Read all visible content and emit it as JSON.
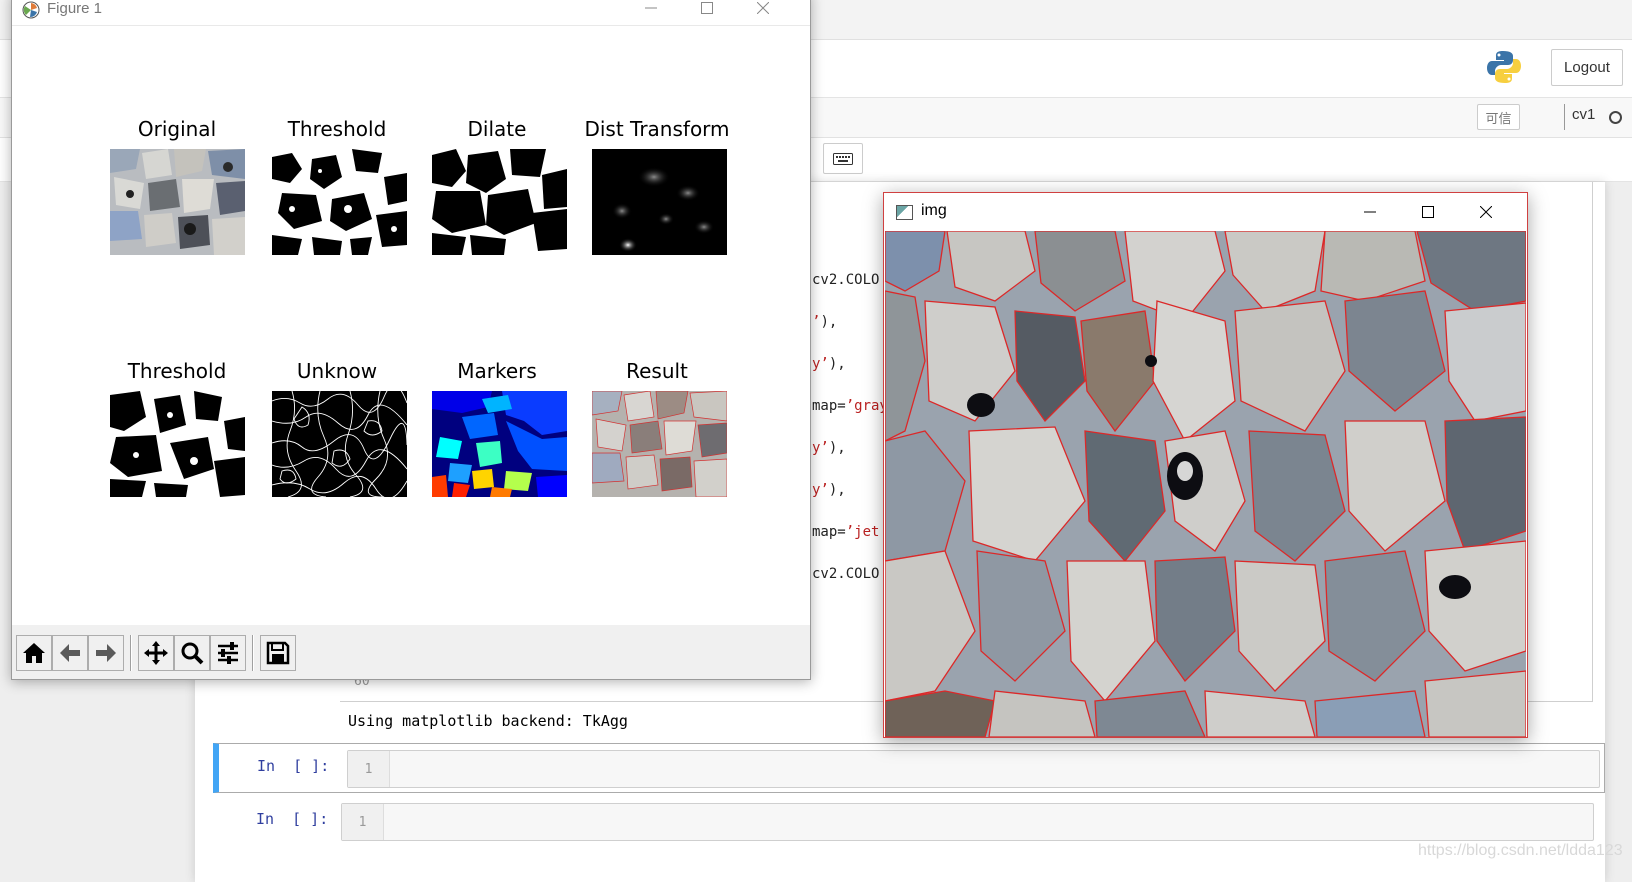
{
  "jupyter": {
    "logout_label": "Logout",
    "trusted_label": "可信",
    "kernel_name": "cv1",
    "code_fragments": [
      {
        "pre": "cv2.COLO",
        "str": "",
        "post": ""
      },
      {
        "pre": "",
        "str": "’",
        "post": "),"
      },
      {
        "pre": "",
        "str": "y’",
        "post": "),"
      },
      {
        "pre": "map=",
        "str": "’gray",
        "post": ""
      },
      {
        "pre": "",
        "str": "y’",
        "post": "),"
      },
      {
        "pre": "",
        "str": "y’",
        "post": "),"
      },
      {
        "pre": "map=",
        "str": "’jet",
        "post": ""
      },
      {
        "pre": "cv2.COLO",
        "str": "",
        "post": ""
      }
    ],
    "last_line_number": "60",
    "output_text": "Using matplotlib backend: TkAgg",
    "cells": [
      {
        "prompt": "In  [ ]:",
        "line": "1"
      },
      {
        "prompt": "In  [ ]:",
        "line": "1"
      }
    ],
    "watermark": "https://blog.csdn.net/ldda123"
  },
  "figure_window": {
    "title": "Figure 1",
    "subplots": [
      {
        "title": "Original"
      },
      {
        "title": "Threshold"
      },
      {
        "title": "Dilate"
      },
      {
        "title": "Dist Transform"
      },
      {
        "title": "Threshold"
      },
      {
        "title": "Unknow"
      },
      {
        "title": "Markers"
      },
      {
        "title": "Result"
      }
    ],
    "toolbar_icons": [
      "home-icon",
      "back-arrow-icon",
      "forward-arrow-icon",
      "pan-icon",
      "zoom-icon",
      "configure-subplots-icon",
      "save-icon"
    ]
  },
  "img_window": {
    "title": "img"
  },
  "colors": {
    "jupyter_prompt": "#303f9f",
    "cell_selected_bar": "#42a5f5",
    "string_literal": "#ba2121",
    "contour": "#e02020",
    "quartz_grain": "#c8c8c4",
    "pore_blue": "#7f98b8"
  }
}
